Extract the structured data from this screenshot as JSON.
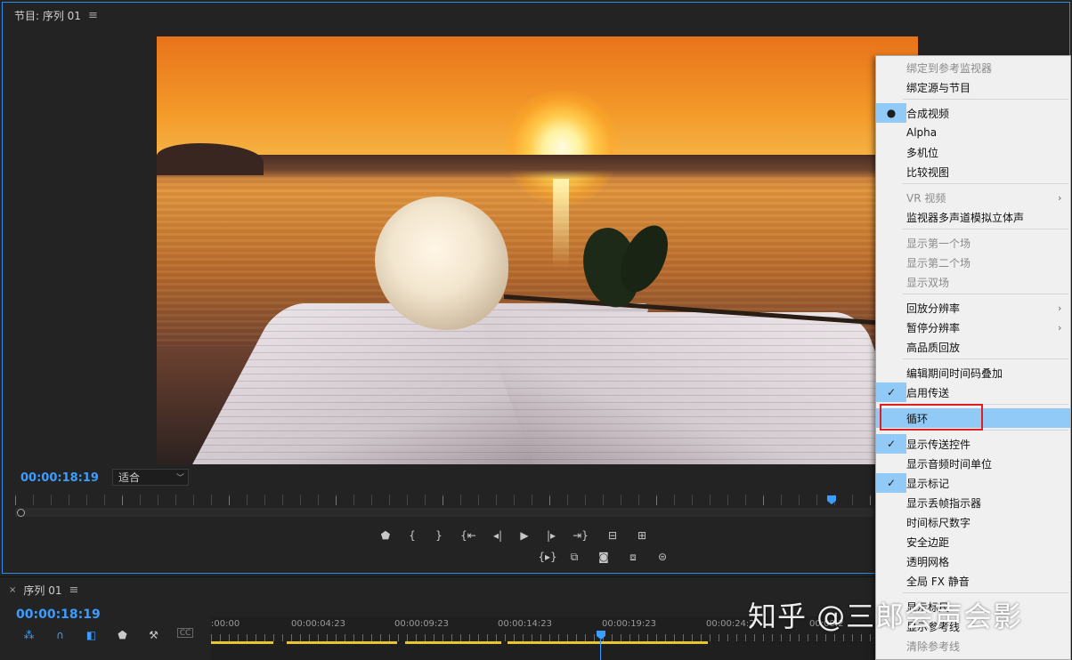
{
  "monitor": {
    "tab_title": "节目: 序列 01",
    "timecode": "00:00:18:19",
    "fit_value": "适合"
  },
  "transport": {
    "row1": [
      "marker-icon",
      "mark-in-icon",
      "mark-out-icon",
      "go-to-in-icon",
      "step-back-icon",
      "play-icon",
      "step-forward-icon",
      "go-to-out-icon",
      "lift-icon",
      "extract-icon"
    ],
    "row2": [
      "play-in-to-out-icon",
      "loop-icon",
      "export-frame-icon",
      "comparison-icon",
      "vr-icon"
    ]
  },
  "sequence": {
    "tab_title": "序列 01",
    "timecode": "00:00:18:19",
    "tick_labels": [
      ":00:00",
      "00:00:04:23",
      "00:00:09:23",
      "00:00:14:23",
      "00:00:19:23",
      "00:00:24:2",
      "00:00:2"
    ]
  },
  "menu": {
    "items": [
      {
        "label": "绑定到参考监视器",
        "disabled": true
      },
      {
        "label": "绑定源与节目"
      },
      {
        "label": "合成视频",
        "mark": "●"
      },
      {
        "label": "Alpha"
      },
      {
        "label": "多机位"
      },
      {
        "label": "比较视图"
      },
      {
        "label": "VR 视频",
        "disabled": true,
        "submenu": "›"
      },
      {
        "label": "监视器多声道模拟立体声"
      },
      {
        "label": "显示第一个场",
        "disabled": true
      },
      {
        "label": "显示第二个场",
        "disabled": true
      },
      {
        "label": "显示双场",
        "disabled": true
      },
      {
        "label": "回放分辨率",
        "submenu": "›"
      },
      {
        "label": "暂停分辨率",
        "submenu": "›"
      },
      {
        "label": "高品质回放"
      },
      {
        "label": "编辑期间时间码叠加"
      },
      {
        "label": "启用传送",
        "mark": "✓"
      },
      {
        "label": "循环"
      },
      {
        "label": "显示传送控件",
        "mark": "✓"
      },
      {
        "label": "显示音频时间单位"
      },
      {
        "label": "显示标记",
        "mark": "✓"
      },
      {
        "label": "显示丢帧指示器"
      },
      {
        "label": "时间标尺数字"
      },
      {
        "label": "安全边距"
      },
      {
        "label": "透明网格"
      },
      {
        "label": "全局 FX 静音"
      },
      {
        "label": "显示标尺"
      },
      {
        "label": "显示参考线"
      },
      {
        "label": "清除参考线",
        "disabled": true
      }
    ]
  },
  "watermark": "知乎 @三郎会声会影",
  "colors": {
    "accent": "#3a9dff",
    "highlight": "#91c9f7",
    "annotation": "#e01f1f",
    "in_out_bar": "#e6c531"
  }
}
